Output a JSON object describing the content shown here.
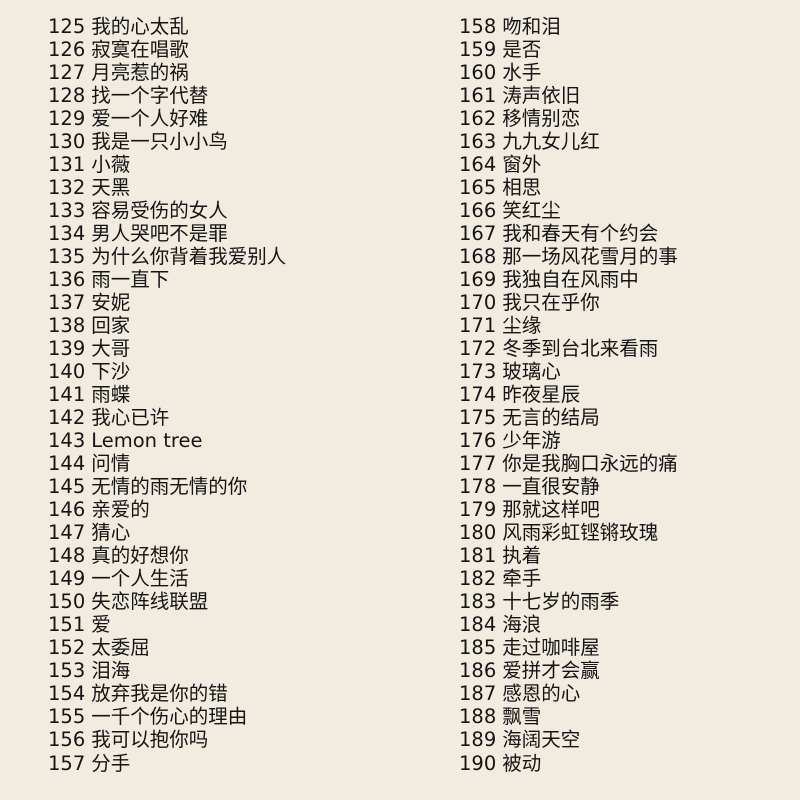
{
  "columns": [
    {
      "items": [
        {
          "num": "125",
          "title": "我的心太乱"
        },
        {
          "num": "126",
          "title": "寂寞在唱歌"
        },
        {
          "num": "127",
          "title": "月亮惹的祸"
        },
        {
          "num": "128",
          "title": "找一个字代替"
        },
        {
          "num": "129",
          "title": "爱一个人好难"
        },
        {
          "num": "130",
          "title": "我是一只小小鸟"
        },
        {
          "num": "131",
          "title": "小薇"
        },
        {
          "num": "132",
          "title": "天黑"
        },
        {
          "num": "133",
          "title": "容易受伤的女人"
        },
        {
          "num": "134",
          "title": "男人哭吧不是罪"
        },
        {
          "num": "135",
          "title": "为什么你背着我爱别人"
        },
        {
          "num": "136",
          "title": "雨一直下"
        },
        {
          "num": "137",
          "title": "安妮"
        },
        {
          "num": "138",
          "title": "回家"
        },
        {
          "num": "139",
          "title": "大哥"
        },
        {
          "num": "140",
          "title": "下沙"
        },
        {
          "num": "141",
          "title": "雨蝶"
        },
        {
          "num": "142",
          "title": "我心已许"
        },
        {
          "num": "143",
          "title": "Lemon tree"
        },
        {
          "num": "144",
          "title": "问情"
        },
        {
          "num": "145",
          "title": "无情的雨无情的你"
        },
        {
          "num": "146",
          "title": "亲爱的"
        },
        {
          "num": "147",
          "title": "猜心"
        },
        {
          "num": "148",
          "title": "真的好想你"
        },
        {
          "num": "149",
          "title": "一个人生活"
        },
        {
          "num": "150",
          "title": "失恋阵线联盟"
        },
        {
          "num": "151",
          "title": "爱"
        },
        {
          "num": "152",
          "title": "太委屈"
        },
        {
          "num": "153",
          "title": "泪海"
        },
        {
          "num": "154",
          "title": "放弃我是你的错"
        },
        {
          "num": "155",
          "title": "一千个伤心的理由"
        },
        {
          "num": "156",
          "title": "我可以抱你吗"
        },
        {
          "num": "157",
          "title": "分手"
        }
      ]
    },
    {
      "items": [
        {
          "num": "158",
          "title": "吻和泪"
        },
        {
          "num": "159",
          "title": "是否"
        },
        {
          "num": "160",
          "title": "水手"
        },
        {
          "num": "161",
          "title": "涛声依旧"
        },
        {
          "num": "162",
          "title": "移情别恋"
        },
        {
          "num": "163",
          "title": "九九女儿红"
        },
        {
          "num": "164",
          "title": "窗外"
        },
        {
          "num": "165",
          "title": "相思"
        },
        {
          "num": "166",
          "title": "笑红尘"
        },
        {
          "num": "167",
          "title": "我和春天有个约会"
        },
        {
          "num": "168",
          "title": "那一场风花雪月的事"
        },
        {
          "num": "169",
          "title": "我独自在风雨中"
        },
        {
          "num": "170",
          "title": "我只在乎你"
        },
        {
          "num": "171",
          "title": "尘缘"
        },
        {
          "num": "172",
          "title": "冬季到台北来看雨"
        },
        {
          "num": "173",
          "title": "玻璃心"
        },
        {
          "num": "174",
          "title": "昨夜星辰"
        },
        {
          "num": "175",
          "title": "无言的结局"
        },
        {
          "num": "176",
          "title": "少年游"
        },
        {
          "num": "177",
          "title": "你是我胸口永远的痛"
        },
        {
          "num": "178",
          "title": "一直很安静"
        },
        {
          "num": "179",
          "title": "那就这样吧"
        },
        {
          "num": "180",
          "title": "风雨彩虹铿锵玫瑰"
        },
        {
          "num": "181",
          "title": "执着"
        },
        {
          "num": "182",
          "title": "牵手"
        },
        {
          "num": "183",
          "title": "十七岁的雨季"
        },
        {
          "num": "184",
          "title": "海浪"
        },
        {
          "num": "185",
          "title": "走过咖啡屋"
        },
        {
          "num": "186",
          "title": "爱拼才会赢"
        },
        {
          "num": "187",
          "title": "感恩的心"
        },
        {
          "num": "188",
          "title": "飘雪"
        },
        {
          "num": "189",
          "title": "海阔天空"
        },
        {
          "num": "190",
          "title": "被动"
        }
      ]
    }
  ],
  "colors": {
    "background": "#f2ebe0",
    "text": "#141414"
  }
}
